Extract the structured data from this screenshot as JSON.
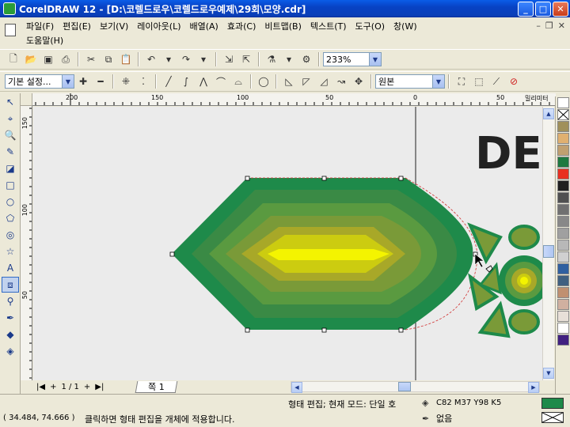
{
  "window": {
    "title": "CorelDRAW 12 - [D:\\코렐드로우\\코렐드로우예제\\29회\\모양.cdr]",
    "minimize_label": "_",
    "maximize_label": "□",
    "close_label": "✕"
  },
  "menu": {
    "items": [
      "파일(F)",
      "편집(E)",
      "보기(V)",
      "레이아웃(L)",
      "배열(A)",
      "효과(C)",
      "비트맵(B)",
      "텍스트(T)",
      "도구(O)",
      "창(W)"
    ],
    "help": "도움말(H)"
  },
  "toolbar1": {
    "zoom": "233%"
  },
  "toolbar2": {
    "preset": "기본 설정...",
    "mode": "원본"
  },
  "ruler": {
    "h_ticks": [
      "200",
      "150",
      "100",
      "50",
      "0",
      "50"
    ],
    "h_unit": "밀리미터",
    "v_ticks": [
      "150",
      "100",
      "50"
    ]
  },
  "canvas": {
    "logo_text": "DE"
  },
  "pager": {
    "page_count": "1 / 1",
    "page_tab": "쪽 1"
  },
  "palette": {
    "colors": [
      "#ffffff",
      "#ffffff",
      "#a0905a",
      "#e0b070",
      "#c0a070",
      "#1e7a40",
      "#e83020",
      "#202020",
      "#505050",
      "#707070",
      "#888888",
      "#a0a0a0",
      "#b8b8b8",
      "#d0d0d0",
      "#3060a0",
      "#406080",
      "#c09070",
      "#d0b0a0",
      "#e8e0d8",
      "#ffffff",
      "#402080"
    ]
  },
  "status": {
    "mode": "형태 편집; 현재 모드: 단일 호",
    "fill": "C82 M37 Y98 K5",
    "outline": "없음",
    "coords": "( 34.484, 74.666 )",
    "hint": "클릭하면 형태 편집을 개체에 적용합니다.",
    "fill_color": "#1e8a4a"
  }
}
